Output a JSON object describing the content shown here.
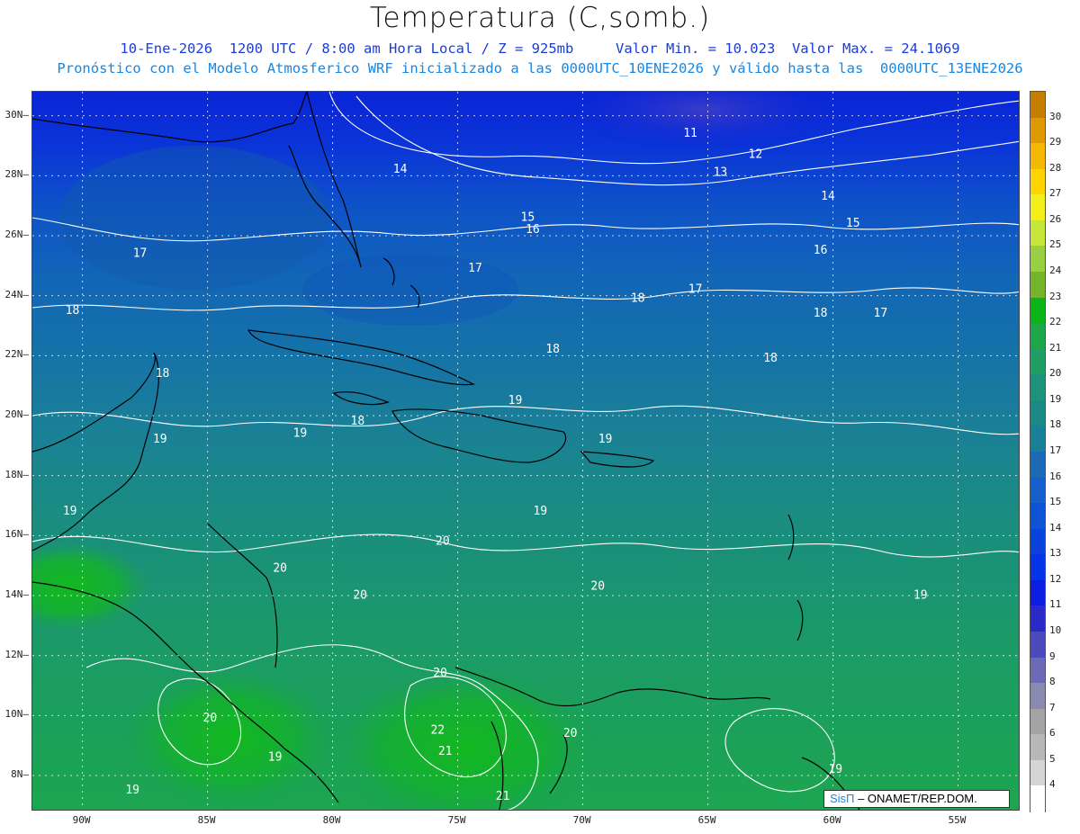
{
  "header": {
    "title": "Temperatura (C,somb.)",
    "line1": "10-Ene-2026  1200 UTC / 8:00 am Hora Local / Z = 925mb     Valor Min. = 10.023  Valor Max. = 24.1069",
    "line2": "Pronóstico con el Modelo Atmosferico WRF inicializado a las 0000UTC_10ENE2026 y válido hasta las  0000UTC_13ENE2026"
  },
  "map": {
    "lon_range": [
      -92,
      -52.5
    ],
    "lat_range": [
      6.8,
      30.8
    ],
    "lat_ticks": [
      "30N",
      "28N",
      "26N",
      "24N",
      "22N",
      "20N",
      "18N",
      "16N",
      "14N",
      "12N",
      "10N",
      "8N"
    ],
    "lon_ticks": [
      "90W",
      "85W",
      "80W",
      "75W",
      "70W",
      "65W",
      "60W",
      "55W"
    ],
    "grid": "dotted",
    "contour_labels": [
      {
        "text": "11",
        "lon": -65.7,
        "lat": 29.4
      },
      {
        "text": "12",
        "lon": -63.1,
        "lat": 28.7
      },
      {
        "text": "13",
        "lon": -64.5,
        "lat": 28.1
      },
      {
        "text": "14",
        "lon": -77.3,
        "lat": 28.2
      },
      {
        "text": "14",
        "lon": -60.2,
        "lat": 27.3
      },
      {
        "text": "15",
        "lon": -72.2,
        "lat": 26.6
      },
      {
        "text": "15",
        "lon": -59.2,
        "lat": 26.4
      },
      {
        "text": "16",
        "lon": -72.0,
        "lat": 26.2
      },
      {
        "text": "16",
        "lon": -60.5,
        "lat": 25.5
      },
      {
        "text": "17",
        "lon": -87.7,
        "lat": 25.4
      },
      {
        "text": "17",
        "lon": -74.3,
        "lat": 24.9
      },
      {
        "text": "17",
        "lon": -65.5,
        "lat": 24.2
      },
      {
        "text": "17",
        "lon": -58.1,
        "lat": 23.4
      },
      {
        "text": "18",
        "lon": -90.4,
        "lat": 23.5
      },
      {
        "text": "18",
        "lon": -67.8,
        "lat": 23.9
      },
      {
        "text": "18",
        "lon": -60.5,
        "lat": 23.4
      },
      {
        "text": "18",
        "lon": -71.2,
        "lat": 22.2
      },
      {
        "text": "18",
        "lon": -62.5,
        "lat": 21.9
      },
      {
        "text": "18",
        "lon": -86.8,
        "lat": 21.4
      },
      {
        "text": "18",
        "lon": -79.0,
        "lat": 19.8
      },
      {
        "text": "19",
        "lon": -72.7,
        "lat": 20.5
      },
      {
        "text": "19",
        "lon": -69.1,
        "lat": 19.2
      },
      {
        "text": "19",
        "lon": -81.3,
        "lat": 19.4
      },
      {
        "text": "19",
        "lon": -86.9,
        "lat": 19.2
      },
      {
        "text": "19",
        "lon": -90.5,
        "lat": 16.8
      },
      {
        "text": "19",
        "lon": -71.7,
        "lat": 16.8
      },
      {
        "text": "19",
        "lon": -56.5,
        "lat": 14.0
      },
      {
        "text": "19",
        "lon": -59.9,
        "lat": 8.2
      },
      {
        "text": "19",
        "lon": -88.0,
        "lat": 7.5
      },
      {
        "text": "19",
        "lon": -82.3,
        "lat": 8.6
      },
      {
        "text": "20",
        "lon": -75.6,
        "lat": 15.8
      },
      {
        "text": "20",
        "lon": -82.1,
        "lat": 14.9
      },
      {
        "text": "20",
        "lon": -78.9,
        "lat": 14.0
      },
      {
        "text": "20",
        "lon": -69.4,
        "lat": 14.3
      },
      {
        "text": "20",
        "lon": -75.7,
        "lat": 11.4
      },
      {
        "text": "20",
        "lon": -84.9,
        "lat": 9.9
      },
      {
        "text": "20",
        "lon": -70.5,
        "lat": 9.4
      },
      {
        "text": "21",
        "lon": -75.5,
        "lat": 8.8
      },
      {
        "text": "21",
        "lon": -73.2,
        "lat": 7.3
      },
      {
        "text": "22",
        "lon": -75.8,
        "lat": 9.5
      }
    ]
  },
  "colorbar": {
    "labels": [
      "30",
      "29",
      "28",
      "27",
      "26",
      "25",
      "24",
      "23",
      "22",
      "21",
      "20",
      "19",
      "18",
      "17",
      "16",
      "15",
      "14",
      "13",
      "12",
      "11",
      "10",
      "9",
      "8",
      "7",
      "6",
      "5",
      "4"
    ],
    "colors": [
      "#c47f00",
      "#de9a00",
      "#f5b800",
      "#ffd400",
      "#f2ee1a",
      "#c6e639",
      "#99cf43",
      "#74b52c",
      "#0ab519",
      "#1ca84a",
      "#1f9f66",
      "#1d947a",
      "#1a8a89",
      "#1a7f99",
      "#1a6ab8",
      "#1560cc",
      "#0e52d6",
      "#0a42dc",
      "#0434e6",
      "#0a1de0",
      "#2a2ac8",
      "#4b4bbe",
      "#6a6ab5",
      "#8a8ab0",
      "#a3a3a3",
      "#b8b8b8",
      "#d5d5d5",
      "#ffffff"
    ]
  },
  "credit": {
    "sis": "SisΠ",
    "text": "– ONAMET/REP.DOM."
  }
}
